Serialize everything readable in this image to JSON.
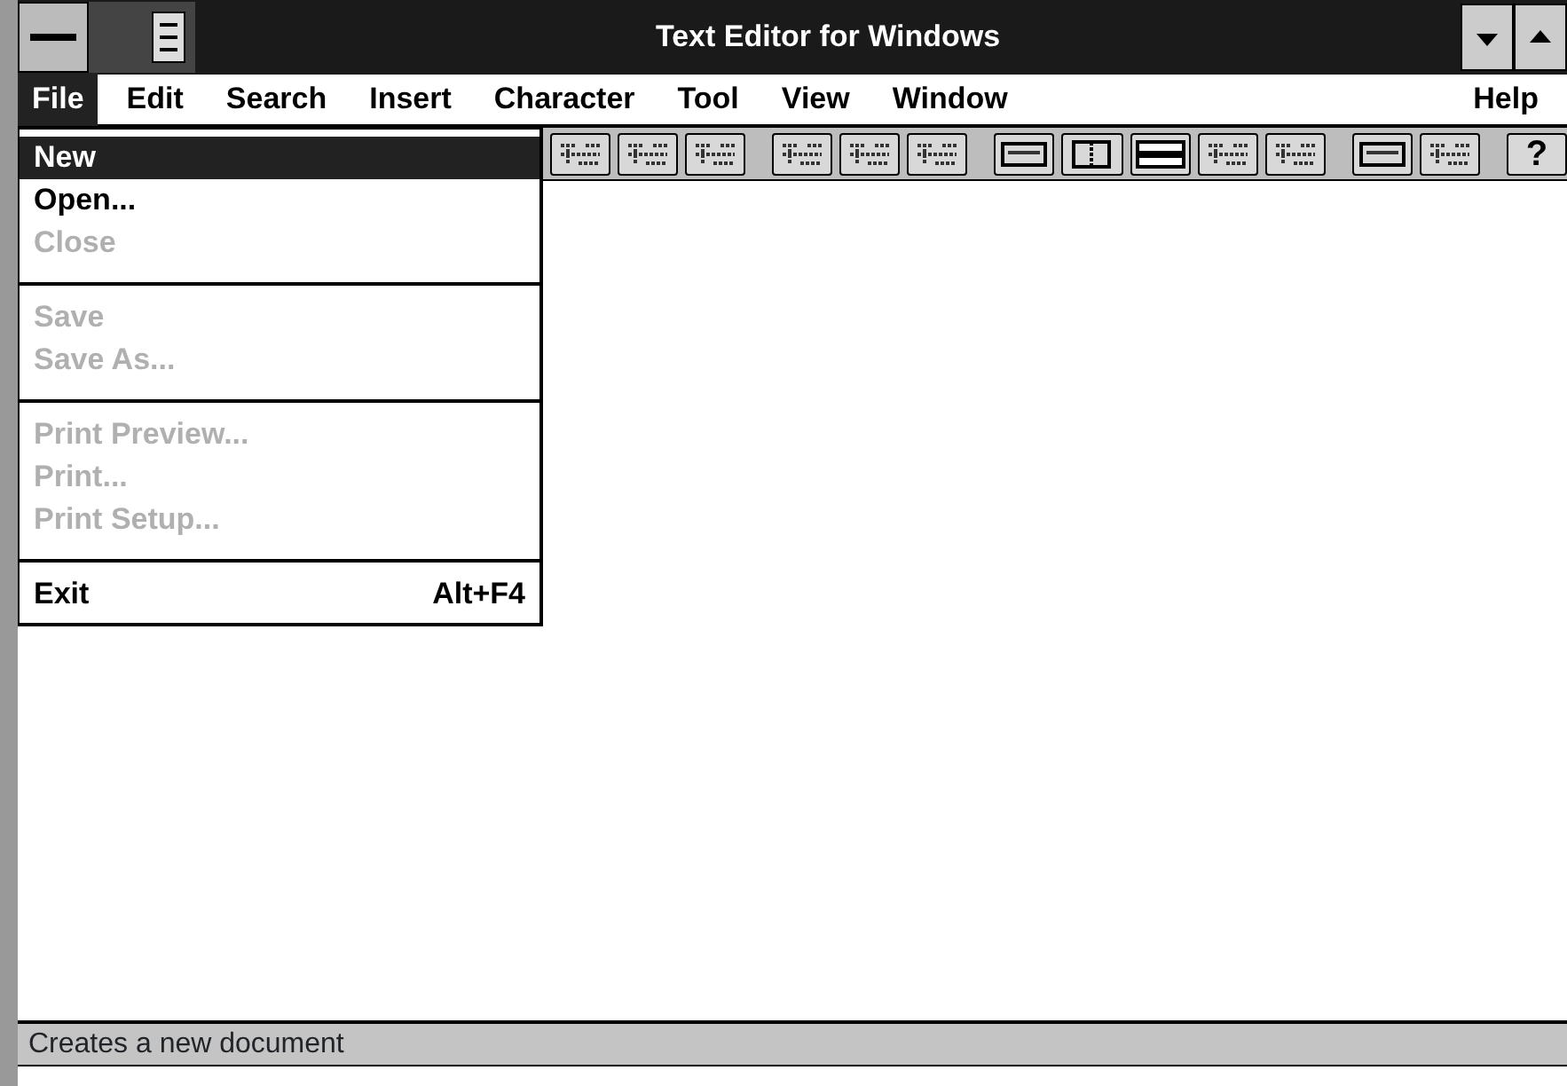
{
  "window": {
    "title": "Text Editor for Windows"
  },
  "menu_bar": [
    {
      "label": "File",
      "selected": true
    },
    {
      "label": "Edit",
      "selected": false
    },
    {
      "label": "Search",
      "selected": false
    },
    {
      "label": "Insert",
      "selected": false
    },
    {
      "label": "Character",
      "selected": false
    },
    {
      "label": "Tool",
      "selected": false
    },
    {
      "label": "View",
      "selected": false
    },
    {
      "label": "Window",
      "selected": false
    },
    {
      "label": "Help",
      "selected": false
    }
  ],
  "toolbar": [
    {
      "kind": "glyph"
    },
    {
      "kind": "glyph"
    },
    {
      "kind": "glyph"
    },
    {
      "kind": "gap"
    },
    {
      "kind": "glyph"
    },
    {
      "kind": "glyph"
    },
    {
      "kind": "glyph"
    },
    {
      "kind": "gap"
    },
    {
      "kind": "frame"
    },
    {
      "kind": "columns"
    },
    {
      "kind": "bars"
    },
    {
      "kind": "glyph"
    },
    {
      "kind": "glyph"
    },
    {
      "kind": "gap"
    },
    {
      "kind": "frame"
    },
    {
      "kind": "glyph"
    },
    {
      "kind": "gap"
    },
    {
      "kind": "text",
      "label": "?"
    }
  ],
  "file_menu": [
    {
      "kind": "item",
      "label": "New",
      "disabled": false,
      "selected": true
    },
    {
      "kind": "item",
      "label": "Open...",
      "disabled": false,
      "selected": false
    },
    {
      "kind": "item",
      "label": "Close",
      "disabled": true,
      "selected": false
    },
    {
      "kind": "separator"
    },
    {
      "kind": "item",
      "label": "Save",
      "disabled": true,
      "selected": false
    },
    {
      "kind": "item",
      "label": "Save As...",
      "disabled": true,
      "selected": false
    },
    {
      "kind": "separator"
    },
    {
      "kind": "item",
      "label": "Print Preview...",
      "disabled": true,
      "selected": false
    },
    {
      "kind": "item",
      "label": "Print...",
      "disabled": true,
      "selected": false
    },
    {
      "kind": "item",
      "label": "Print Setup...",
      "disabled": true,
      "selected": false
    },
    {
      "kind": "separator"
    },
    {
      "kind": "item",
      "label": "Exit",
      "shortcut": "Alt+F4",
      "disabled": false,
      "selected": false
    }
  ],
  "status_bar": "Creates a new document"
}
